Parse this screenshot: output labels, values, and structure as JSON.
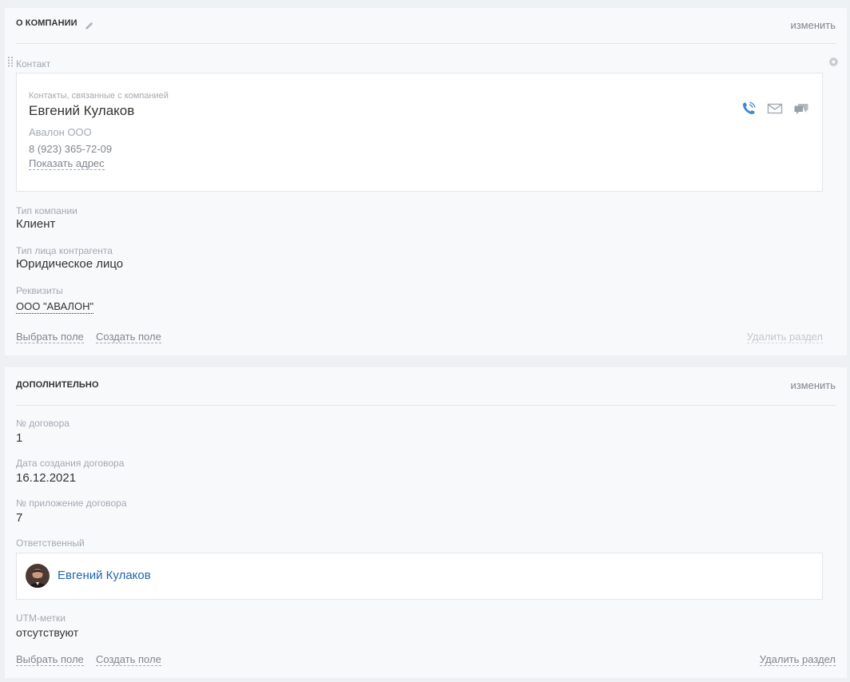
{
  "company_section": {
    "title": "О КОМПАНИИ",
    "change_label": "изменить",
    "contact_field_label": "Контакт",
    "contact_card": {
      "label": "Контакты, связанные с компанией",
      "name": "Евгений Кулаков",
      "company": "Авалон ООО",
      "phone": "8 (923) 365-72-09",
      "address_link": "Показать адрес",
      "icons": [
        "phone-icon",
        "mail-icon",
        "chat-icon"
      ]
    },
    "company_type": {
      "label": "Тип компании",
      "value": "Клиент"
    },
    "entity_type": {
      "label": "Тип лица контрагента",
      "value": "Юридическое лицо"
    },
    "requisites": {
      "label": "Реквизиты",
      "value": "ООО \"АВАЛОН\""
    },
    "footer": {
      "select_field": "Выбрать поле",
      "create_field": "Создать поле",
      "delete_section": "Удалить раздел"
    }
  },
  "additional_section": {
    "title": "ДОПОЛНИТЕЛЬНО",
    "change_label": "изменить",
    "contract_number": {
      "label": "№ договора",
      "value": "1"
    },
    "contract_date": {
      "label": "Дата создания договора",
      "value": "16.12.2021"
    },
    "contract_appendix": {
      "label": "№ приложение договора",
      "value": "7"
    },
    "responsible": {
      "label": "Ответственный",
      "name": "Евгений Кулаков"
    },
    "utm": {
      "label": "UTM-метки",
      "value": "отсутствуют"
    },
    "footer": {
      "select_field": "Выбрать поле",
      "create_field": "Создать поле",
      "delete_section": "Удалить раздел"
    }
  },
  "colors": {
    "accent_link": "#2067b0",
    "phone_icon": "#3f87d9",
    "muted_text": "#a3a9b1",
    "section_bg": "#f8f9fb",
    "page_bg": "#eef1f4"
  }
}
